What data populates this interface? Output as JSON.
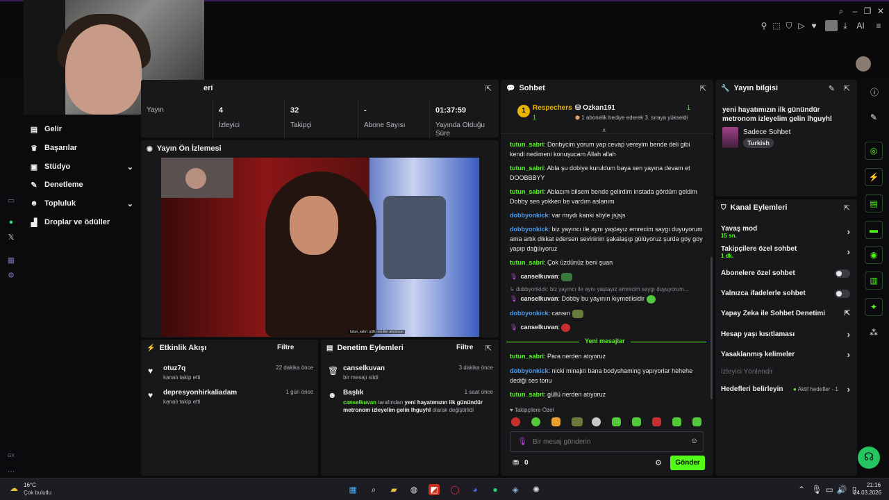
{
  "browser": {
    "top_icons": [
      "pin-icon",
      "crop-icon",
      "shield-icon",
      "play-icon",
      "heart-icon",
      "profile-icon",
      "download-icon",
      "ai-icon",
      "menu-icon"
    ],
    "ai_label": "AI"
  },
  "nav": {
    "items": [
      {
        "label": "Gelir",
        "icon": "money-icon"
      },
      {
        "label": "Başarılar",
        "icon": "trophy-icon"
      },
      {
        "label": "Stüdyo",
        "icon": "studio-icon",
        "expand": true
      },
      {
        "label": "Denetleme",
        "icon": "wrench-icon"
      },
      {
        "label": "Topluluk",
        "icon": "people-icon",
        "expand": true
      },
      {
        "label": "Droplar ve ödüller",
        "icon": "gift-icon"
      }
    ],
    "rail_label": "GX"
  },
  "stats": {
    "title_fragment": "eri",
    "items": [
      {
        "value": "",
        "label": "Yayın"
      },
      {
        "value": "4",
        "label": "İzleyici"
      },
      {
        "value": "32",
        "label": "Takipçi"
      },
      {
        "value": "-",
        "label": "Abone Sayısı"
      },
      {
        "value": "01:37:59",
        "label": "Yayında Olduğu Süre"
      }
    ]
  },
  "preview": {
    "title": "Yayın Ön İzlemesi",
    "caption": "tutun_sabri: güllü nerden atıyorsun"
  },
  "activity": {
    "title": "Etkinlik Akışı",
    "filter_label": "Filtre",
    "items": [
      {
        "name": "otuz7q",
        "sub": "kanalı takip etti",
        "time": "22 dakika önce"
      },
      {
        "name": "depresyonhirkaliadam",
        "sub": "kanalı takip etti",
        "time": "1 gün önce"
      }
    ]
  },
  "moderation": {
    "title": "Denetim Eylemleri",
    "filter_label": "Filtre",
    "items": [
      {
        "name": "canselkuvan",
        "sub": "bir mesajı sildi",
        "time": "3 dakika önce"
      },
      {
        "name": "Başlık",
        "time": "1 saat önce",
        "actor": "canselkuvan",
        "mid": " tarafından ",
        "title": "yeni hayatımızın ilk günündür metronom izleyelim gelin lhguyhl",
        "tail": " olarak değiştirildi"
      }
    ]
  },
  "chat": {
    "title": "Sohbet",
    "gift": {
      "rank": "1",
      "user1": "Respechers",
      "count1": "1",
      "user2": "Ozkan191",
      "count2": "1",
      "desc": "1 abonelik hediye ederek 3. sıraya yükseldi"
    },
    "messages": [
      {
        "user": "tutun_sabri",
        "color": "green",
        "text": "Donbycim yorum yap cevap vereyim bende deli gibi kendi nedimeni konuşucam Allah allah"
      },
      {
        "user": "tutun_sabri",
        "color": "green",
        "text": "Abla şu dobiye kuruldum baya sen yayına devam et DOOBBBYY"
      },
      {
        "user": "tutun_sabri",
        "color": "green",
        "text": "Ablacım bilsem bende gelirdim instada gördüm geldim Dobby sen yokken be vardım aslanım"
      },
      {
        "user": "dobbyonkick",
        "color": "blue",
        "text": "var mıydı kanki söyle jsjsjs"
      },
      {
        "user": "dobbyonkick",
        "color": "blue",
        "text": "biz yayıncı ile aynı yaştayız emrecim saygı duyuyorum ama artık dikkat edersen sevinirim şakalaşıp gülüyoruz şurda goy goy yapıp dağılıyoruz"
      },
      {
        "user": "tutun_sabri",
        "color": "green",
        "text": "Çok üzdünüz beni şuan"
      },
      {
        "user": "canselkuvan",
        "color": "pink",
        "text": ""
      },
      {
        "reply": "dobbyonkick: biz yayıncı ile aynı yaştayız emrecim saygı duyuyorum..."
      },
      {
        "user": "canselkuvan",
        "color": "pink",
        "text": "Dobby bu yayının kıymetlisidir"
      },
      {
        "user": "dobbyonkick",
        "color": "blue",
        "text": "cansın"
      },
      {
        "user": "canselkuvan",
        "color": "pink",
        "text": ""
      },
      {
        "divider": "Yeni mesajlar"
      },
      {
        "user": "tutun_sabri",
        "color": "green",
        "text": "Para nerden atıyoruz"
      },
      {
        "user": "dobbyonkick",
        "color": "blue",
        "text": "nicki minajın bana bodyshaming yapıyorlar hehehe dediği ses tonu"
      },
      {
        "user": "tutun_sabri",
        "color": "green",
        "text": "güllü nerden atıyoruz"
      }
    ],
    "follower_label": "Takipçilere Özel",
    "input_placeholder": "Bir mesaj gönderin",
    "points": "0",
    "send_label": "Gönder"
  },
  "stream_info": {
    "title": "Yayın bilgisi",
    "stream_title": "yeni hayatımızın ilk günündür metronom izleyelim gelin lhguyhl",
    "category": "Sadece Sohbet",
    "language": "Turkish"
  },
  "channel_actions": {
    "title": "Kanal Eylemleri",
    "slow_mode": {
      "label": "Yavaş mod",
      "value": "15 sn."
    },
    "followers_only": {
      "label": "Takipçilere özel sohbet",
      "value": "1 dk."
    },
    "subs_only": {
      "label": "Abonelere özel sohbet",
      "on": false
    },
    "emotes_only": {
      "label": "Yalnızca ifadelerle sohbet",
      "on": false
    },
    "ai_mod": "Yapay Zeka ile Sohbet Denetimi",
    "age_restriction": "Hesap yaşı kısıtlaması",
    "banned_words": "Yasaklanmış kelimeler",
    "viewer_redirect": "İzleyici Yönlendir",
    "goals": "Hedefleri belirleyin",
    "goals_status": "Aktif hedefler - 1"
  },
  "right_rail": {
    "icons": [
      "info-icon",
      "edit-icon",
      "camera-icon",
      "lightning-icon",
      "list-icon",
      "chat-icon",
      "broadcast-icon",
      "layout-icon",
      "wrench-icon",
      "nodes-icon"
    ]
  },
  "taskbar": {
    "weather_temp": "16°C",
    "weather_desc": "Çok bulutlu",
    "time": "21:16",
    "date": "24.03.2026"
  },
  "colors": {
    "accent": "#53fc18",
    "panel": "#18181b",
    "background": "#0b0b0e"
  }
}
